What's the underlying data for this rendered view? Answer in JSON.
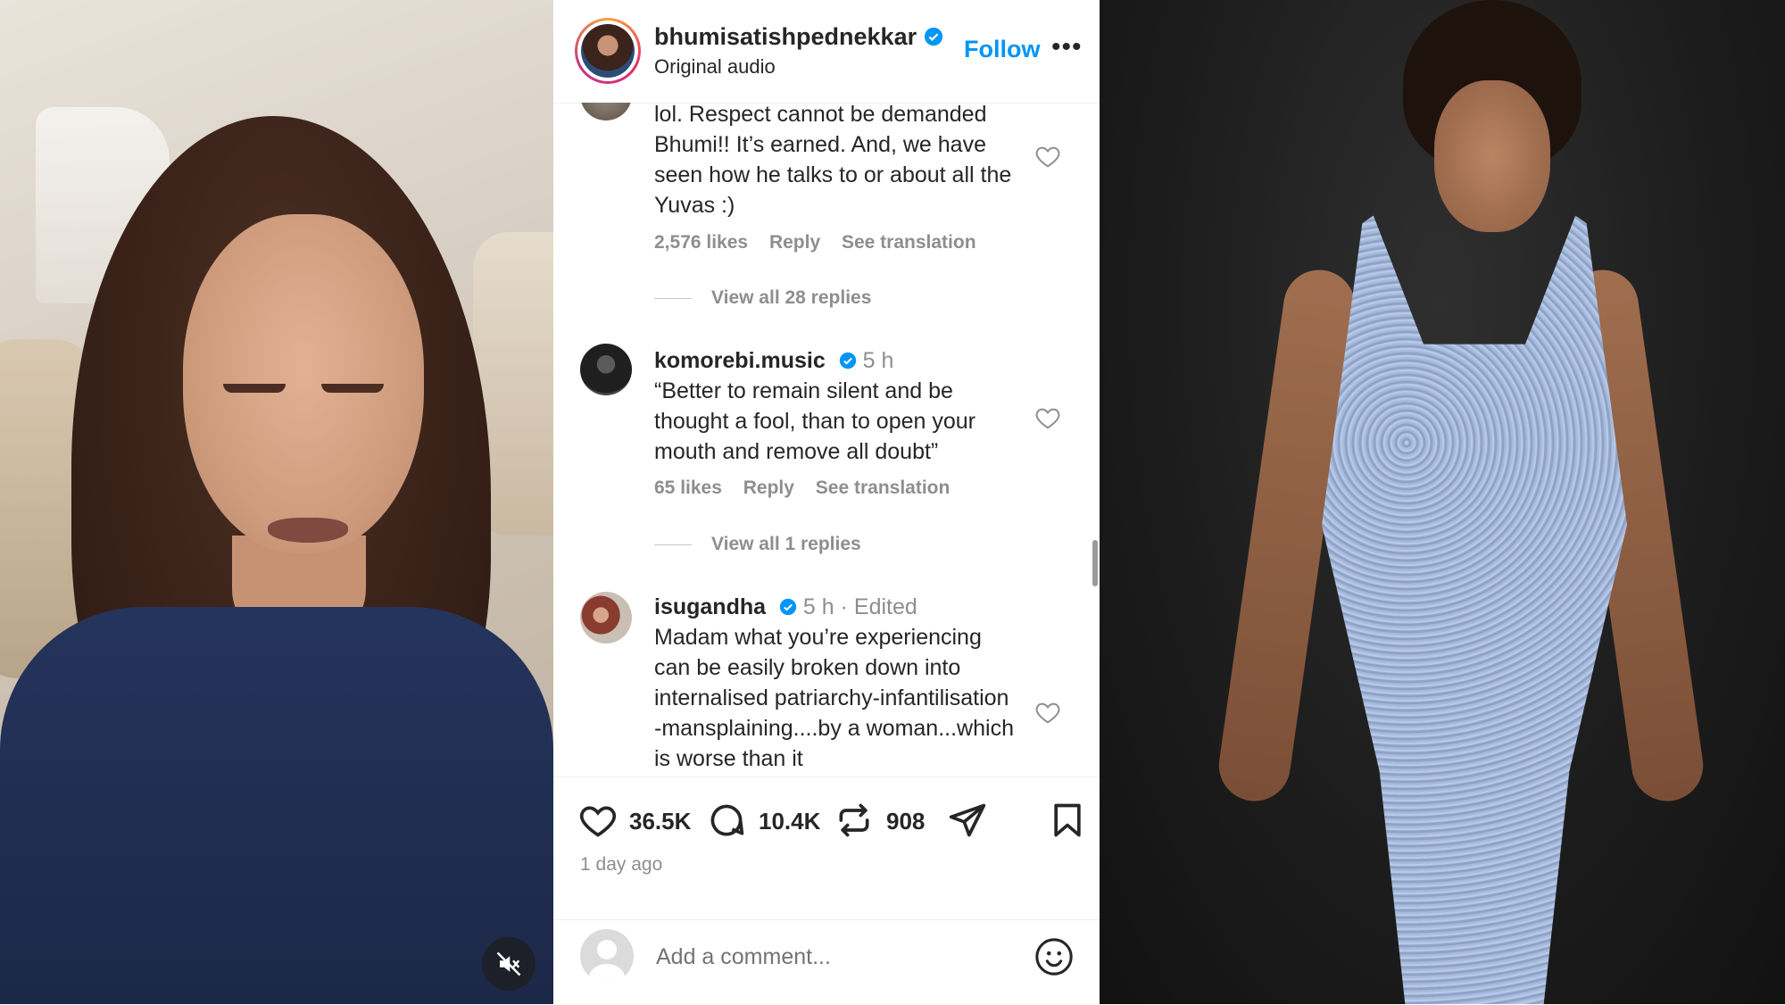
{
  "header": {
    "username": "bhumisatishpednekkar",
    "subtitle": "Original audio",
    "follow_label": "Follow",
    "more_label": "•••"
  },
  "comments": [
    {
      "text": "lol. Respect cannot be demanded Bhumi!! It’s earned. And, we have seen how he talks to or about all the Yuvas :)",
      "likes": "2,576 likes",
      "reply_label": "Reply",
      "translation_label": "See translation",
      "view_replies": "View all 28 replies"
    },
    {
      "username": "komorebi.music",
      "time": "5 h",
      "text": "“Better to remain silent and be thought a fool, than to open your mouth and remove all doubt”",
      "likes": "65 likes",
      "reply_label": "Reply",
      "translation_label": "See translation",
      "view_replies": "View all 1 replies"
    },
    {
      "username": "isugandha",
      "time": "5 h · Edited",
      "text": "Madam what you’re experiencing can be easily broken down into internalised patriarchy-infantilisation -mansplaining....by a woman...which is worse than it"
    }
  ],
  "actions": {
    "likes": "36.5K",
    "comments": "10.4K",
    "reposts": "908",
    "time_ago": "1 day ago"
  },
  "add_comment": {
    "placeholder": "Add a comment..."
  },
  "colors": {
    "accent": "#0095f6",
    "text": "#262626",
    "muted": "#8e8e8e"
  },
  "icons": [
    "verified-icon",
    "heart-icon",
    "comment-icon",
    "repost-icon",
    "share-icon",
    "bookmark-icon",
    "emoji-icon",
    "mute-icon"
  ]
}
